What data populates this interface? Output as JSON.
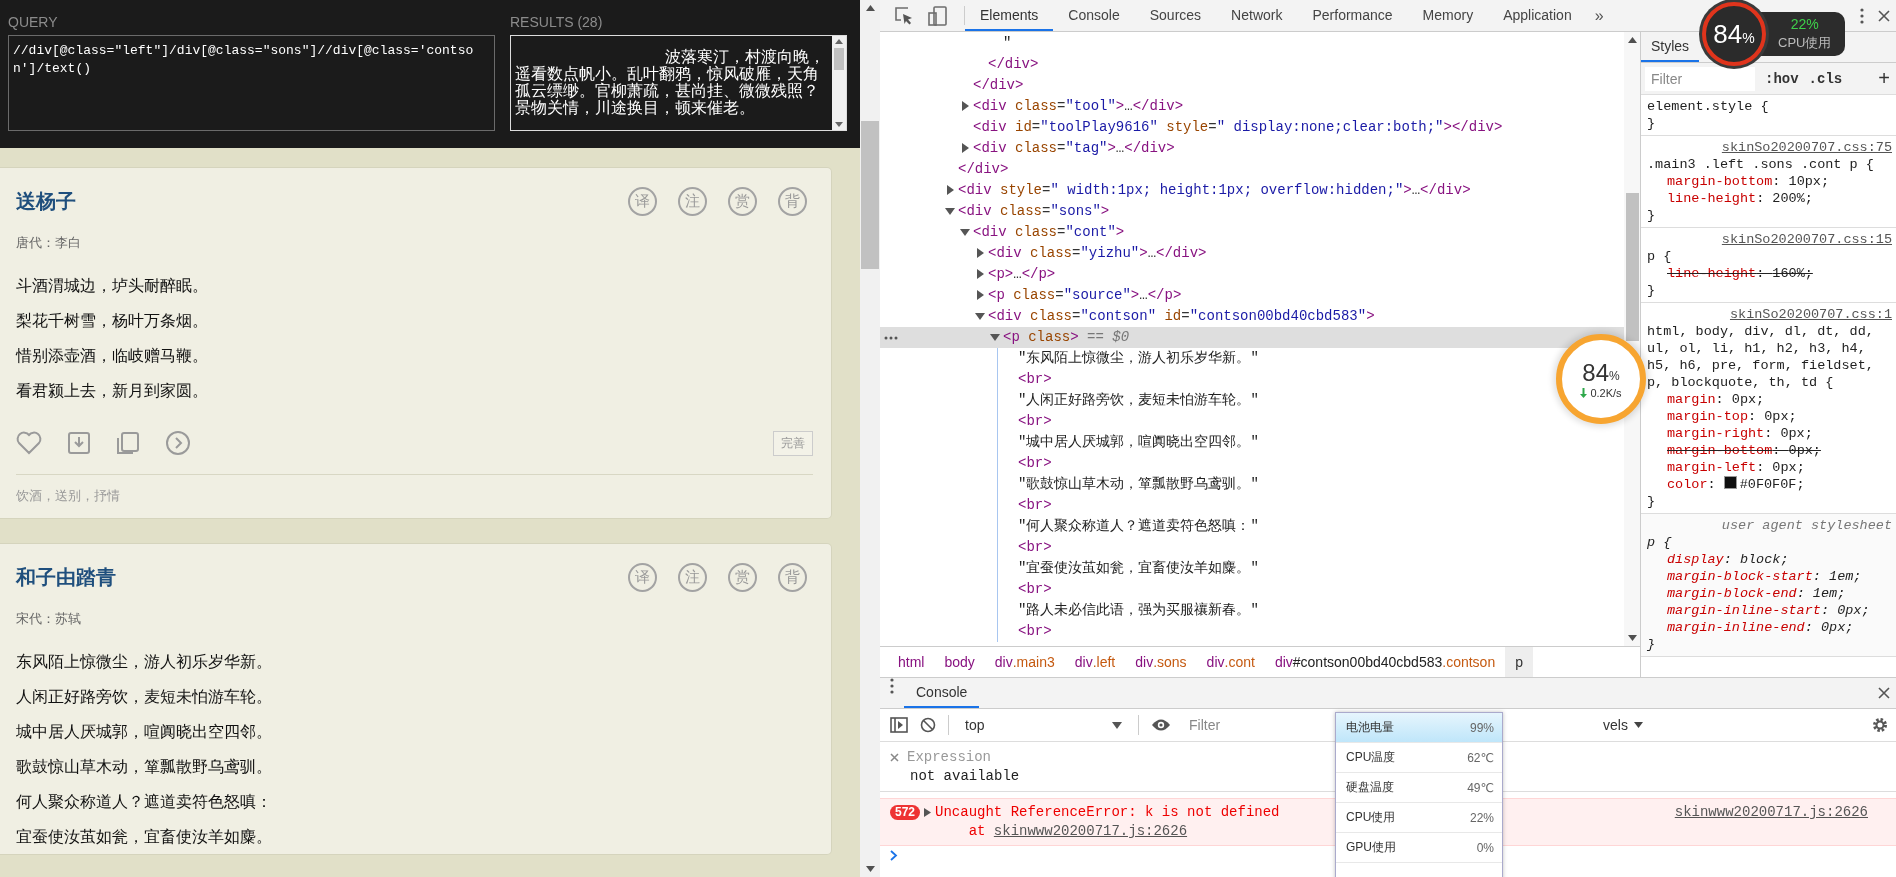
{
  "query_panel": {
    "query_label": "QUERY",
    "query": "//div[@class=\"left\"]/div[@class=\"sons\"]//div[@class='contson']/text()",
    "results_label": "RESULTS (28)",
    "results": "波落寒汀，村渡向晚，遥看数点帆小。乱叶翻鸦，惊风破雁，天角孤云缥缈。官柳萧疏，甚尚挂、微微残照？景物关情，川途换目，顿来催老。"
  },
  "poems": [
    {
      "title": "送杨子",
      "tools": [
        "译",
        "注",
        "赏",
        "背"
      ],
      "author": "唐代：李白",
      "lines": [
        "斗酒渭城边，垆头耐醉眠。",
        "梨花千树雪，杨叶万条烟。",
        "惜别添壶酒，临岐赠马鞭。",
        "看君颍上去，新月到家圆。"
      ],
      "perfect": "完善",
      "tags": "饮酒，送别，抒情"
    },
    {
      "title": "和子由踏青",
      "tools": [
        "译",
        "注",
        "赏",
        "背"
      ],
      "author": "宋代：苏轼",
      "lines": [
        "东风陌上惊微尘，游人初乐岁华新。",
        "人闲正好路旁饮，麦短未怕游车轮。",
        "城中居人厌城郭，喧阗晓出空四邻。",
        "歌鼓惊山草木动，箪瓢散野乌鸢驯。",
        "何人聚众称道人？遮道卖符色怒嗔：",
        "宜蚕使汝茧如瓮，宜畜使汝羊如麋。"
      ]
    }
  ],
  "devtools": {
    "tabs": [
      {
        "label": "Elements",
        "selected": true
      },
      {
        "label": "Console",
        "selected": false
      },
      {
        "label": "Sources",
        "selected": false
      },
      {
        "label": "Network",
        "selected": false
      },
      {
        "label": "Performance",
        "selected": false
      },
      {
        "label": "Memory",
        "selected": false
      },
      {
        "label": "Application",
        "selected": false
      }
    ],
    "more": "»",
    "dom_tree": [
      {
        "children": [
          {
            "children": [
              {
                "children": [
                  {
                    "kind": "text",
                    "markup": "\"",
                    "selected": false
                  }
                ],
                "closing": "</div>"
              }
            ],
            "closing": "</div>"
          },
          {
            "kind": "element",
            "markup": "<div class=\"tool\">…</div>",
            "expanded": false,
            "selected": false
          },
          {
            "kind": "element",
            "markup": "<div id=\"toolPlay9616\" style=\" display:none;clear:both;\"></div>",
            "selected": false
          },
          {
            "kind": "element",
            "markup": "<div class=\"tag\">…</div>",
            "expanded": false,
            "selected": false
          }
        ],
        "closing": "</div>"
      },
      {
        "kind": "element",
        "markup": "<div style=\" width:1px; height:1px; overflow:hidden;\">…</div>",
        "expanded": false,
        "selected": false
      },
      {
        "kind": "element",
        "markup": "<div class=\"sons\">",
        "expanded": true,
        "selected": false,
        "children": [
          {
            "kind": "element",
            "markup": "<div class=\"cont\">",
            "expanded": true,
            "selected": false,
            "children": [
              {
                "kind": "element",
                "markup": "<div class=\"yizhu\">…</div>",
                "expanded": false,
                "selected": false
              },
              {
                "kind": "element",
                "markup": "<p>…</p>",
                "expanded": false,
                "selected": false
              },
              {
                "kind": "element",
                "markup": "<p class=\"source\">…</p>",
                "expanded": false,
                "selected": false
              },
              {
                "kind": "element",
                "markup": "<div class=\"contson\" id=\"contson00bd40cbd583\">",
                "expanded": true,
                "selected": false,
                "children": [
                  {
                    "kind": "element",
                    "markup": "<p class>",
                    "note": "== $0",
                    "expanded": true,
                    "selected": true,
                    "children": [
                      {
                        "kind": "text",
                        "markup": "\"东风陌上惊微尘，游人初乐岁华新。\"",
                        "selected": false
                      },
                      {
                        "kind": "element",
                        "markup": "<br>",
                        "selected": false
                      },
                      {
                        "kind": "text",
                        "markup": "\"人闲正好路旁饮，麦短未怕游车轮。\"",
                        "selected": false
                      },
                      {
                        "kind": "element",
                        "markup": "<br>",
                        "selected": false
                      },
                      {
                        "kind": "text",
                        "markup": "\"城中居人厌城郭，喧阗晓出空四邻。\"",
                        "selected": false
                      },
                      {
                        "kind": "element",
                        "markup": "<br>",
                        "selected": false
                      },
                      {
                        "kind": "text",
                        "markup": "\"歌鼓惊山草木动，箪瓢散野乌鸢驯。\"",
                        "selected": false
                      },
                      {
                        "kind": "element",
                        "markup": "<br>",
                        "selected": false
                      },
                      {
                        "kind": "text",
                        "markup": "\"何人聚众称道人？遮道卖符色怒嗔：\"",
                        "selected": false
                      },
                      {
                        "kind": "element",
                        "markup": "<br>",
                        "selected": false
                      },
                      {
                        "kind": "text",
                        "markup": "\"宜蚕使汝茧如瓮，宜畜使汝羊如麋。\"",
                        "selected": false
                      },
                      {
                        "kind": "element",
                        "markup": "<br>",
                        "selected": false
                      },
                      {
                        "kind": "text",
                        "markup": "\"路人未必信此语，强为买服禳新春。\"",
                        "selected": false
                      },
                      {
                        "kind": "element",
                        "markup": "<br>",
                        "selected": false
                      }
                    ]
                  }
                ]
              }
            ]
          }
        ]
      }
    ],
    "breadcrumb": [
      {
        "label": "html",
        "selected": false
      },
      {
        "label": "body",
        "selected": false
      },
      {
        "label": "div.main3",
        "selected": false
      },
      {
        "label": "div.left",
        "selected": false
      },
      {
        "label": "div.sons",
        "selected": false
      },
      {
        "label": "div.cont",
        "selected": false
      },
      {
        "label": "div#contson00bd40cbd583.contson",
        "selected": false
      },
      {
        "label": "p",
        "selected": true
      }
    ],
    "styles": {
      "tabs": [
        {
          "label": "Styles",
          "selected": true
        }
      ],
      "filter_placeholder": "Filter",
      "hov": ":hov",
      "cls": ".cls",
      "add": "+",
      "rules": [
        {
          "kind": "author",
          "selector": "element.style {",
          "close": "}"
        },
        {
          "kind": "author",
          "selector": ".main3 .left .sons .cont p {",
          "source": "skinSo20200707.css:75",
          "props": [
            {
              "text": "margin-bottom: 10px;",
              "struck": false
            },
            {
              "text": "line-height: 200%;",
              "struck": false
            }
          ],
          "close": "}"
        },
        {
          "kind": "author",
          "selector": "p {",
          "source": "skinSo20200707.css:15",
          "props": [
            {
              "text": "line-height: 160%;",
              "struck": true
            }
          ],
          "close": "}"
        },
        {
          "kind": "author",
          "selector": "html, body, div, dl, dt, dd, ul, ol, li, h1, h2, h3, h4, h5, h6, pre, form, fieldset, p, blockquote, th, td {",
          "source": "skinSo20200707.css:1",
          "props": [
            {
              "text": "margin: 0px;",
              "struck": false
            },
            {
              "text": "margin-top: 0px;",
              "struck": false
            },
            {
              "text": "margin-right: 0px;",
              "struck": false
            },
            {
              "text": "margin-bottom: 0px;",
              "struck": true
            },
            {
              "text": "margin-left: 0px;",
              "struck": false
            },
            {
              "text": "color: #0F0F0F;",
              "struck": false,
              "color": "#0f0f0f"
            }
          ],
          "close": "}"
        },
        {
          "kind": "user-agent",
          "selector": "p {",
          "source": "user agent stylesheet",
          "props": [
            {
              "text": "display: block;",
              "struck": false
            },
            {
              "text": "margin-block-start: 1em;",
              "struck": false
            },
            {
              "text": "margin-block-end: 1em;",
              "struck": false
            },
            {
              "text": "margin-inline-start: 0px;",
              "struck": false
            },
            {
              "text": "margin-inline-end: 0px;",
              "struck": false
            }
          ],
          "close": "}"
        }
      ]
    }
  },
  "console": {
    "tab": "Console",
    "context": "top",
    "filter_placeholder": "Filter",
    "levels": "vels",
    "expressions": [
      {
        "label": "Expression",
        "result": "not available"
      }
    ],
    "error": {
      "count": "572",
      "message": "Uncaught ReferenceError: k is not defined",
      "at": "at",
      "file": "skinwww20200717.js:2626",
      "source": "skinwww20200717.js:2626"
    }
  },
  "cpu_widget": {
    "value": "84",
    "unit": "%",
    "cpu": "22%",
    "label": "CPU使用"
  },
  "float_ball": {
    "value": "84",
    "unit": "%",
    "speed": "0.2K/s"
  },
  "hw_popup": [
    {
      "label": "电池电量",
      "value": "99%",
      "selected": true
    },
    {
      "label": "CPU温度",
      "value": "62℃",
      "selected": false
    },
    {
      "label": "硬盘温度",
      "value": "49℃",
      "selected": false
    },
    {
      "label": "CPU使用",
      "value": "22%",
      "selected": false
    },
    {
      "label": "GPU使用",
      "value": "0%",
      "selected": false
    }
  ]
}
